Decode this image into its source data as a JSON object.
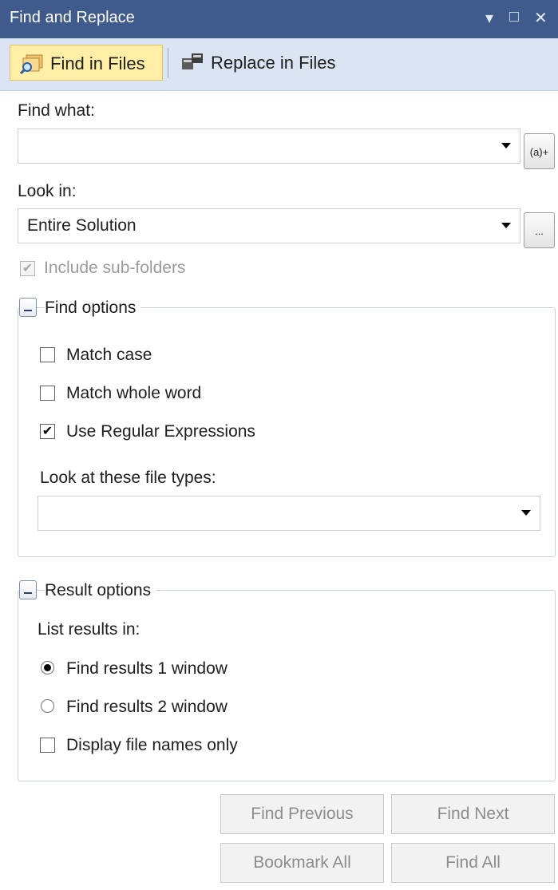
{
  "window": {
    "title": "Find and Replace"
  },
  "title_controls": {
    "menu": "▾",
    "maximize": "□",
    "close": "✕"
  },
  "toolbar": {
    "find_in_files": "Find in Files",
    "replace_in_files": "Replace in Files"
  },
  "find_what": {
    "label": "Find what:",
    "value": "",
    "regex_builder_label": "(a)+"
  },
  "look_in": {
    "label": "Look in:",
    "value": "Entire Solution",
    "browse_label": "..."
  },
  "include_subfolders": {
    "label": "Include sub-folders",
    "checked": true,
    "enabled": false
  },
  "find_options": {
    "title": "Find options",
    "match_case": {
      "label": "Match case",
      "checked": false
    },
    "match_whole_word": {
      "label": "Match whole word",
      "checked": false
    },
    "use_regex": {
      "label": "Use Regular Expressions",
      "checked": true
    },
    "file_types_label": "Look at these file types:",
    "file_types_value": ""
  },
  "result_options": {
    "title": "Result options",
    "list_results_label": "List results in:",
    "options": [
      {
        "label": "Find results 1 window",
        "selected": true
      },
      {
        "label": "Find results 2 window",
        "selected": false
      }
    ],
    "display_file_names_only": {
      "label": "Display file names only",
      "checked": false
    }
  },
  "buttons": {
    "find_previous": "Find Previous",
    "find_next": "Find Next",
    "bookmark_all": "Bookmark All",
    "find_all": "Find All"
  },
  "glyphs": {
    "check": "✔"
  },
  "colors": {
    "titlebar": "#3f5b8c",
    "toolbar": "#dbe4f2",
    "active_tool": "#ffefa6",
    "disabled_text": "#9b9b9b"
  }
}
